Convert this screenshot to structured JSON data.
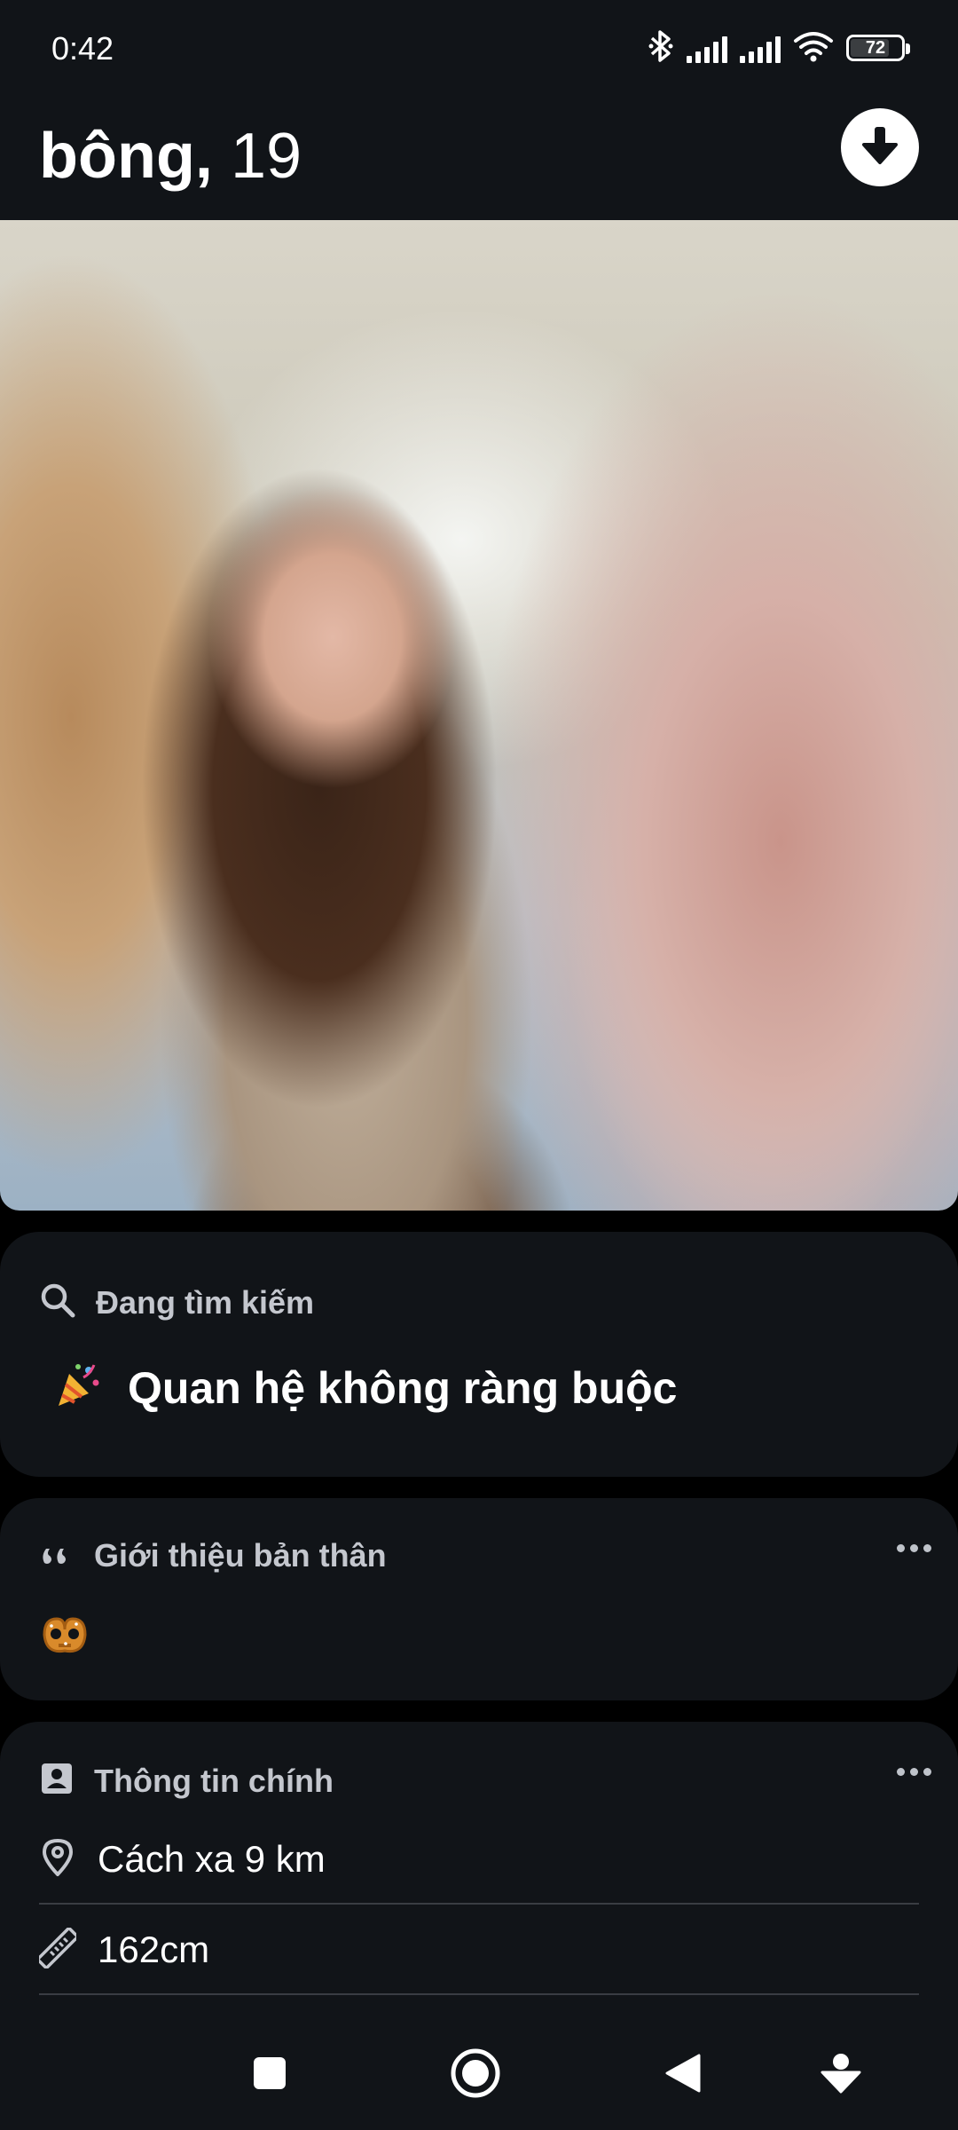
{
  "status_bar": {
    "time": "0:42",
    "battery_level": "72",
    "icons": [
      "bluetooth-icon",
      "signal-icon",
      "signal-icon",
      "wifi-icon",
      "battery-icon"
    ]
  },
  "header": {
    "name": "bông,",
    "age": "19",
    "collapse_icon": "arrow-down-icon"
  },
  "photo": {
    "alt": "profile-photo"
  },
  "looking_for": {
    "title": "Đang tìm kiếm",
    "icon": "search-icon",
    "emoji": "🎉",
    "value": "Quan hệ không ràng buộc"
  },
  "bio": {
    "title": "Giới thiệu bản thân",
    "icon": "quote-icon",
    "emoji": "🥨"
  },
  "basic_info": {
    "title": "Thông tin chính",
    "icon": "id-card-icon",
    "rows": [
      {
        "icon": "location-pin-icon",
        "text": "Cách xa 9 km"
      },
      {
        "icon": "ruler-icon",
        "text": "162cm"
      }
    ]
  },
  "navbar": {
    "buttons": [
      "recents-icon",
      "home-icon",
      "back-icon",
      "dropdown-icon"
    ]
  },
  "colors": {
    "background": "#000000",
    "card": "#111418",
    "muted_text": "#c4c7ce",
    "divider": "#3a3d43"
  }
}
